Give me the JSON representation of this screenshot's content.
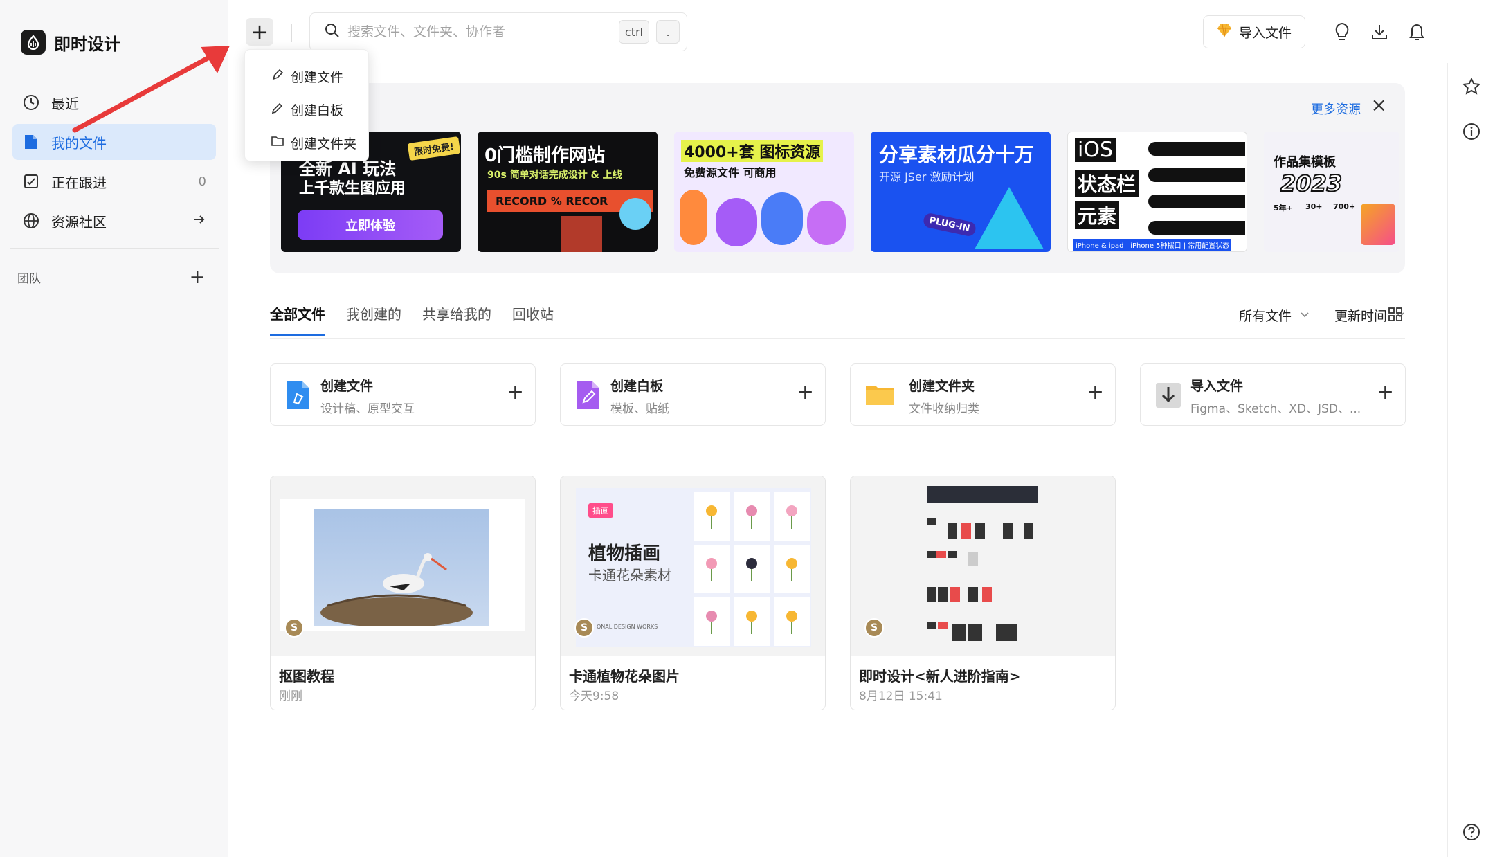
{
  "app": {
    "name": "即时设计"
  },
  "sidebar": {
    "items": [
      {
        "label": "最近",
        "icon": "clock-icon"
      },
      {
        "label": "我的文件",
        "icon": "file-icon",
        "active": true
      },
      {
        "label": "正在跟进",
        "icon": "follow-icon",
        "count": "0"
      },
      {
        "label": "资源社区",
        "icon": "globe-icon"
      }
    ],
    "team_label": "团队"
  },
  "topbar": {
    "search_placeholder": "搜索文件、文件夹、协作者",
    "shortcut_key1": "ctrl",
    "shortcut_key2": ".",
    "import_label": "导入文件"
  },
  "new_menu": {
    "items": [
      {
        "label": "创建文件",
        "icon": "pen-icon"
      },
      {
        "label": "创建白板",
        "icon": "pencil-icon"
      },
      {
        "label": "创建文件夹",
        "icon": "folder-icon"
      }
    ]
  },
  "resources": {
    "more_label": "更多资源",
    "banners": [
      {
        "line1": "全新 AI 玩法",
        "line2": "上千款生图应用",
        "button": "立即体验",
        "tag": "限时免费!"
      },
      {
        "line1": "0门槛制作网站",
        "line2": "90s 简单对话完成设计 & 上线",
        "line3": "RECORD % RECOR"
      },
      {
        "line1": "4000+套 图标资源",
        "line2": "免费源文件  可商用"
      },
      {
        "line1": "分享素材瓜分十万",
        "line2": "开源 JSer 激励计划",
        "line3": "PLUG-IN"
      },
      {
        "line1": "iOS",
        "line2": "状态栏",
        "line3": "元素",
        "line4": "iPhone & ipad | iPhone 5种摆口 | 常用配置状态"
      },
      {
        "line1": "作品集模板",
        "line2": "2023",
        "stats": [
          "5年+",
          "30+",
          "700+"
        ]
      }
    ]
  },
  "tabs": [
    "全部文件",
    "我创建的",
    "共享给我的",
    "回收站"
  ],
  "filters": {
    "type": "所有文件",
    "sort": "更新时间"
  },
  "quick_create": [
    {
      "title": "创建文件",
      "subtitle": "设计稿、原型交互",
      "icon": "design-file-icon"
    },
    {
      "title": "创建白板",
      "subtitle": "模板、贴纸",
      "icon": "whiteboard-icon"
    },
    {
      "title": "创建文件夹",
      "subtitle": "文件收纳归类",
      "icon": "folder-icon"
    },
    {
      "title": "导入文件",
      "subtitle": "Figma、Sketch、XD、JSD、...",
      "icon": "import-icon"
    }
  ],
  "files": [
    {
      "title": "抠图教程",
      "time": "刚刚",
      "avatar": "S"
    },
    {
      "title": "卡通植物花朵图片",
      "time": "今天9:58",
      "avatar": "S",
      "thumb_badge": "插画",
      "thumb_title": "植物插画",
      "thumb_subtitle": "卡通花朵素材",
      "thumb_footer": "ONAL  DESIGN WORKS"
    },
    {
      "title": "即时设计<新人进阶指南>",
      "time": "8月12日 15:41",
      "avatar": "S"
    }
  ],
  "colors": {
    "accent": "#1d6ce0",
    "arrow": "#e83a3a",
    "active_bg": "#dbe9fb"
  }
}
